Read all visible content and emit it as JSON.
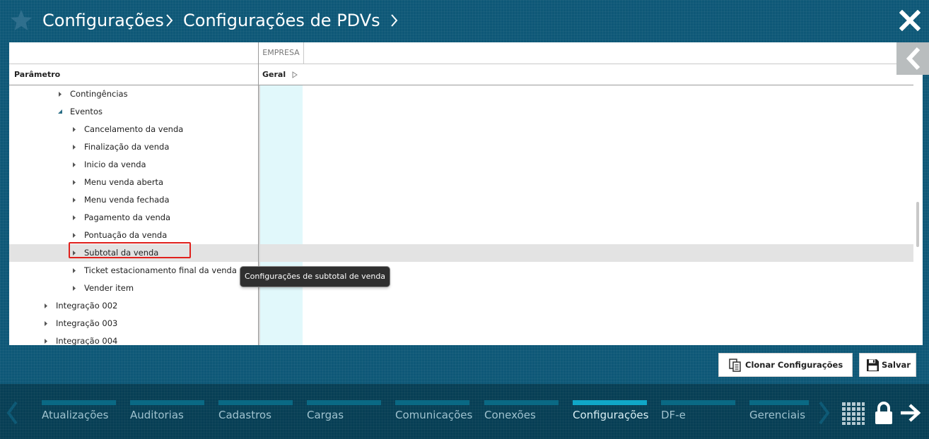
{
  "header": {
    "crumbs": [
      "Configurações",
      "Configurações de PDVs"
    ],
    "icons": {
      "favorite": "star-icon",
      "close": "close-icon",
      "separator": "chevron-right-icon"
    }
  },
  "grid": {
    "column_group": "EMPRESA",
    "param_header": "Parâmetro",
    "column_header": "Geral",
    "tree": [
      {
        "label": "Contingências",
        "level": 1,
        "expanded": false
      },
      {
        "label": "Eventos",
        "level": 1,
        "expanded": true
      },
      {
        "label": "Cancelamento da venda",
        "level": 2,
        "expanded": false
      },
      {
        "label": "Finalização da venda",
        "level": 2,
        "expanded": false
      },
      {
        "label": "Inicio da venda",
        "level": 2,
        "expanded": false
      },
      {
        "label": "Menu venda aberta",
        "level": 2,
        "expanded": false
      },
      {
        "label": "Menu venda fechada",
        "level": 2,
        "expanded": false
      },
      {
        "label": "Pagamento da venda",
        "level": 2,
        "expanded": false
      },
      {
        "label": "Pontuação da venda",
        "level": 2,
        "expanded": false
      },
      {
        "label": "Subtotal da venda",
        "level": 2,
        "expanded": false,
        "selected": true
      },
      {
        "label": "Ticket estacionamento final da venda",
        "level": 2,
        "expanded": false
      },
      {
        "label": "Vender item",
        "level": 2,
        "expanded": false
      },
      {
        "label": "Integração 002",
        "level": 0,
        "expanded": false
      },
      {
        "label": "Integração 003",
        "level": 0,
        "expanded": false
      },
      {
        "label": "Integração 004",
        "level": 0,
        "expanded": false
      }
    ],
    "tooltip": "Configurações de subtotal de venda"
  },
  "actions": {
    "clone_label": "Clonar Configurações",
    "save_label": "Salvar",
    "clone_icon": "clone-document-icon",
    "save_icon": "floppy-disk-icon"
  },
  "footer": {
    "tabs": [
      "Atualizações",
      "Auditorias",
      "Cadastros",
      "Cargas",
      "Comunicações",
      "Conexões",
      "Configurações",
      "DF-e",
      "Gerenciais"
    ],
    "active_tab": "Configurações",
    "icons": {
      "apps": "apps-grid-icon",
      "lock": "lock-icon",
      "logout": "logout-arrow-icon"
    }
  },
  "colors": {
    "background": "#0e5877",
    "footer": "#073f55",
    "tab_bar": "#0a6984",
    "tab_bar_active": "#10a7c7",
    "highlight": "#e0201c",
    "column_band": "#e1f8fb"
  }
}
